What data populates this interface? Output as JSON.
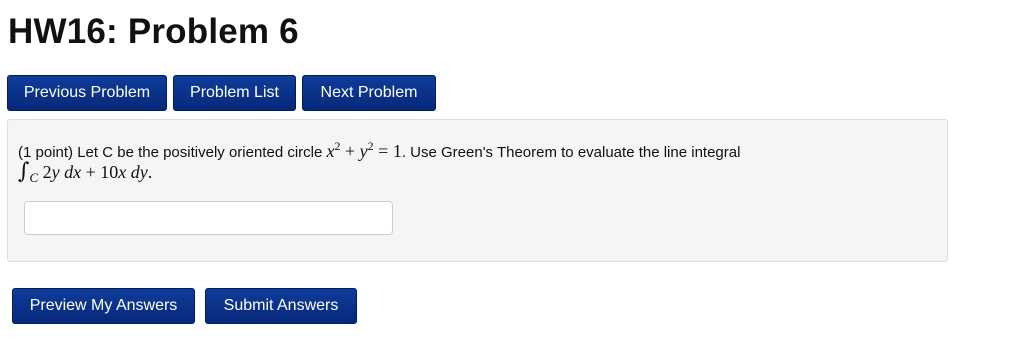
{
  "page_title": "HW16: Problem 6",
  "nav": {
    "previous": "Previous Problem",
    "list": "Problem List",
    "next": "Next Problem"
  },
  "problem": {
    "points": "(1 point)",
    "text_before": "Let C be the positively oriented circle",
    "math_circle_x": "x",
    "math_circle_exp1": "2",
    "math_plus": "+",
    "math_circle_y": "y",
    "math_circle_exp2": "2",
    "math_eq": "= 1",
    "text_after": ". Use Green's Theorem to evaluate the line integral",
    "integral_sign": "∫",
    "integral_sub": "C",
    "integral_expr_1": "2",
    "integral_expr_2": "y dx",
    "integral_plus": "+",
    "integral_expr_3": "10",
    "integral_expr_4": "x dy",
    "integral_end": ".",
    "answer_value": ""
  },
  "actions": {
    "preview": "Preview My Answers",
    "submit": "Submit Answers"
  },
  "colors": {
    "button_bg": "#0a318a",
    "panel_bg": "#f5f5f5"
  }
}
